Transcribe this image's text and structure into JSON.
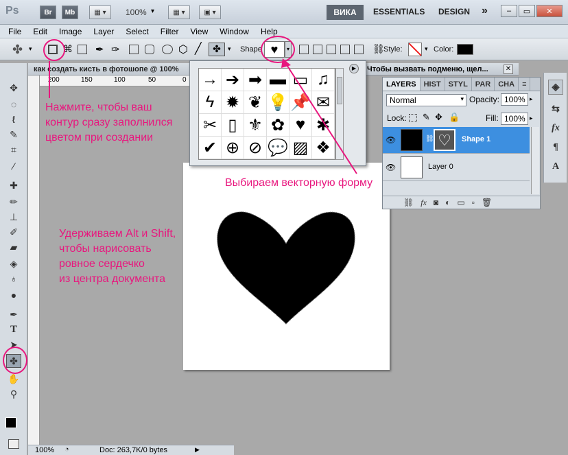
{
  "appbar": {
    "logo": "Ps",
    "bridge_label": "Br",
    "minibridge_label": "Mb",
    "zoom": "100%",
    "workspaces": [
      "ВИКА",
      "ESSENTIALS",
      "DESIGN"
    ],
    "overflow": "»"
  },
  "menu": [
    "File",
    "Edit",
    "Image",
    "Layer",
    "Select",
    "Filter",
    "View",
    "Window",
    "Help"
  ],
  "options": {
    "shape_label": "Shape",
    "style_label": "Style:",
    "color_label": "Color:",
    "color_value": "#000000"
  },
  "documents": {
    "tab1": "как создать кисть в фотошопе @ 100%",
    "tab2": "Чтобы вызвать подменю, щел..."
  },
  "ruler": [
    "200",
    "150",
    "100",
    "50",
    "0"
  ],
  "picker": {
    "shapes": [
      "→",
      "➔",
      "➡",
      "▬",
      "▭",
      "♫",
      "ϟ",
      "✹",
      "❦",
      "💡",
      "📌",
      "✉",
      "✂",
      "▯",
      "⚜",
      "✿",
      "♥",
      "✱",
      "✔",
      "⊕",
      "⊘",
      "💬",
      "▨",
      "❖"
    ]
  },
  "layers": {
    "tabs": [
      "LAYERS",
      "HIST",
      "STYL",
      "PAR",
      "CHA"
    ],
    "blend_mode": "Normal",
    "opacity_label": "Opacity:",
    "opacity": "100%",
    "lock_label": "Lock:",
    "fill_label": "Fill:",
    "fill": "100%",
    "items": [
      {
        "name": "Shape 1",
        "selected": true
      },
      {
        "name": "Layer 0",
        "selected": false
      }
    ]
  },
  "annotations": {
    "note1": [
      "Нажмите, чтобы ваш",
      "контур сразу заполнился",
      "цветом при создании"
    ],
    "note2": "Выбираем векторную форму",
    "note3": [
      "Удерживаем Alt и Shift,",
      "чтобы нарисовать",
      "ровное сердечко",
      "из центра документа"
    ]
  },
  "status": {
    "zoom": "100%",
    "doc": "Doc: 263,7K/0 bytes"
  },
  "colors": {
    "accent": "#e8177e",
    "selection": "#3d8fe0"
  }
}
